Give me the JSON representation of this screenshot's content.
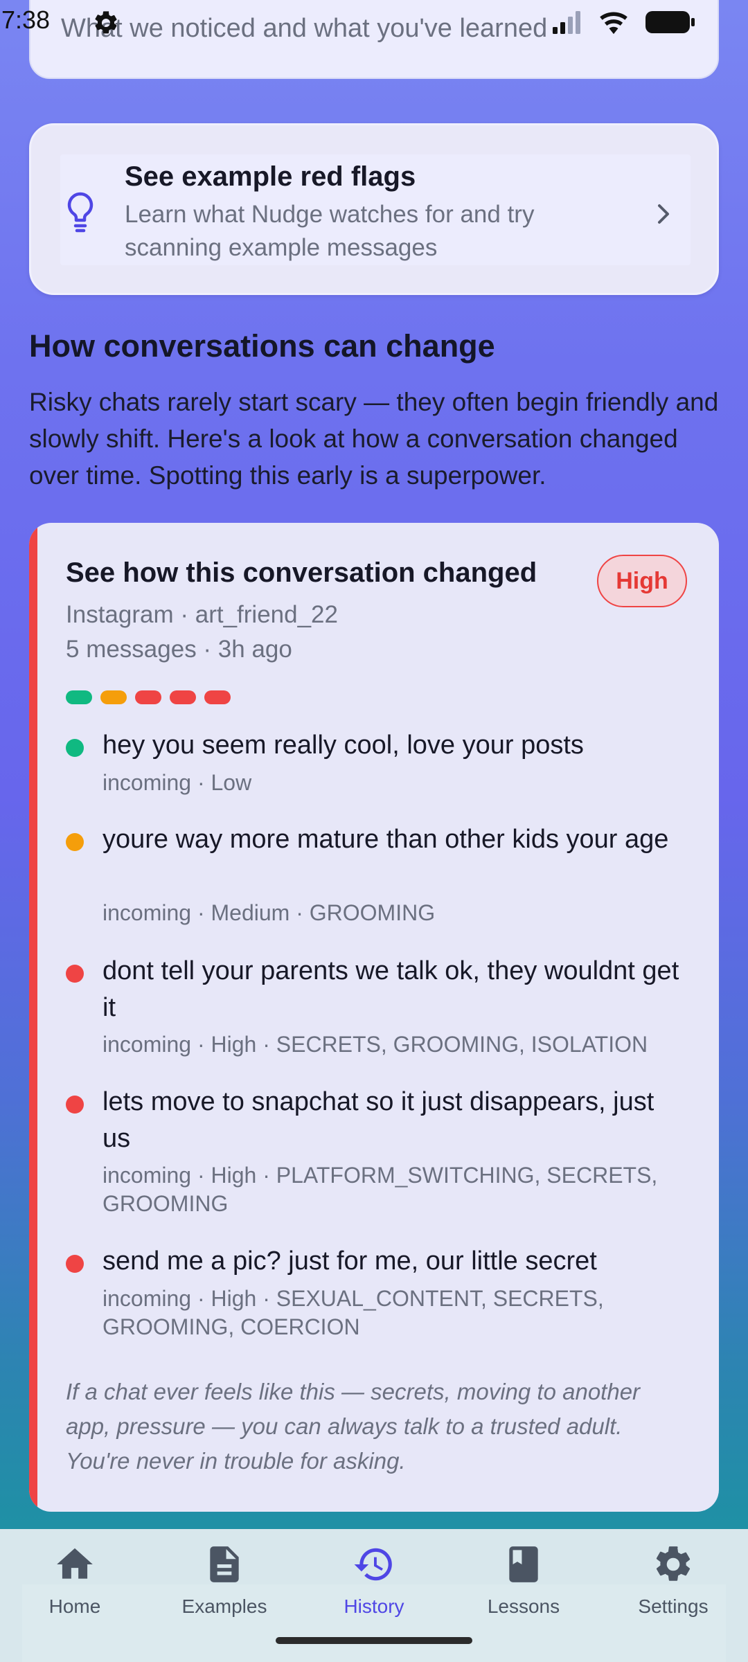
{
  "status_bar": {
    "time": "7:38"
  },
  "top_card": {
    "subtitle": "What we noticed and what you've learned"
  },
  "red_flags_card": {
    "title": "See example red flags",
    "description": "Learn what Nudge watches for and try scanning example messages"
  },
  "section": {
    "title": "How conversations can change",
    "text": "Risky chats rarely start scary — they often begin friendly and slowly shift. Here's a look at how a conversation changed over time. Spotting this early is a superpower."
  },
  "conversation": {
    "title": "See how this conversation changed",
    "risk_level": "High",
    "meta_line1": "Instagram · art_friend_22",
    "meta_line2": "5 messages · 3h ago",
    "colors": {
      "low": "#10b981",
      "medium": "#f59e0b",
      "high": "#ef4444"
    },
    "messages": [
      {
        "text": "hey you seem really cool, love your posts",
        "meta": "incoming · Low"
      },
      {
        "text": "youre way more mature than other kids your age",
        "meta": "incoming · Medium · GROOMING"
      },
      {
        "text": "dont tell your parents we talk ok, they wouldnt get it",
        "meta": "incoming · High · SECRETS, GROOMING, ISOLATION"
      },
      {
        "text": "lets move to snapchat so it just disappears, just us",
        "meta": "incoming · High · PLATFORM_SWITCHING, SECRETS, GROOMING"
      },
      {
        "text": "send me a pic? just for me, our little secret",
        "meta": "incoming · High · SEXUAL_CONTENT, SECRETS, GROOMING, COERCION"
      }
    ],
    "footer": "If a chat ever feels like this — secrets, moving to another app, pressure — you can always talk to a trusted adult. You're never in trouble for asking."
  },
  "nav": {
    "accent": "#4f46e5",
    "items": [
      {
        "label": "Home",
        "icon": "home-icon"
      },
      {
        "label": "Examples",
        "icon": "document-icon"
      },
      {
        "label": "History",
        "icon": "history-icon"
      },
      {
        "label": "Lessons",
        "icon": "book-icon"
      },
      {
        "label": "Settings",
        "icon": "gear-icon"
      }
    ],
    "active": "History"
  }
}
